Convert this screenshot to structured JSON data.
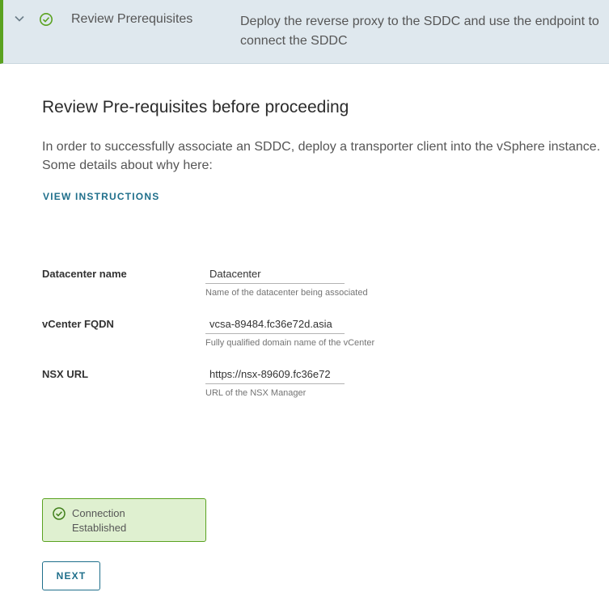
{
  "step": {
    "title": "Review Prerequisites",
    "description": "Deploy the reverse proxy to the SDDC and use the endpoint to connect the SDDC"
  },
  "content": {
    "title": "Review Pre-requisites before proceeding",
    "intro": "In order to successfully associate an SDDC, deploy a transporter client into the vSphere instance. Some details about why here:",
    "view_instructions": "VIEW INSTRUCTIONS"
  },
  "form": {
    "datacenter": {
      "label": "Datacenter name",
      "value": "Datacenter",
      "help": "Name of the datacenter being associated"
    },
    "vcenter": {
      "label": "vCenter FQDN",
      "value": "vcsa-89484.fc36e72d.asia",
      "help": "Fully qualified domain name of the vCenter"
    },
    "nsx": {
      "label": "NSX URL",
      "value": "https://nsx-89609.fc36e72",
      "help": "URL of the NSX Manager"
    }
  },
  "status": {
    "text": "Connection Established"
  },
  "actions": {
    "next": "NEXT"
  },
  "colors": {
    "accent": "#1f6f8b",
    "success": "#5aa220",
    "header_bg": "#dfe8ee",
    "alert_bg": "#dff0d0"
  },
  "icons": {
    "expand": "chevron-down-icon",
    "step_complete": "check-circle-icon",
    "status": "check-circle-icon"
  }
}
